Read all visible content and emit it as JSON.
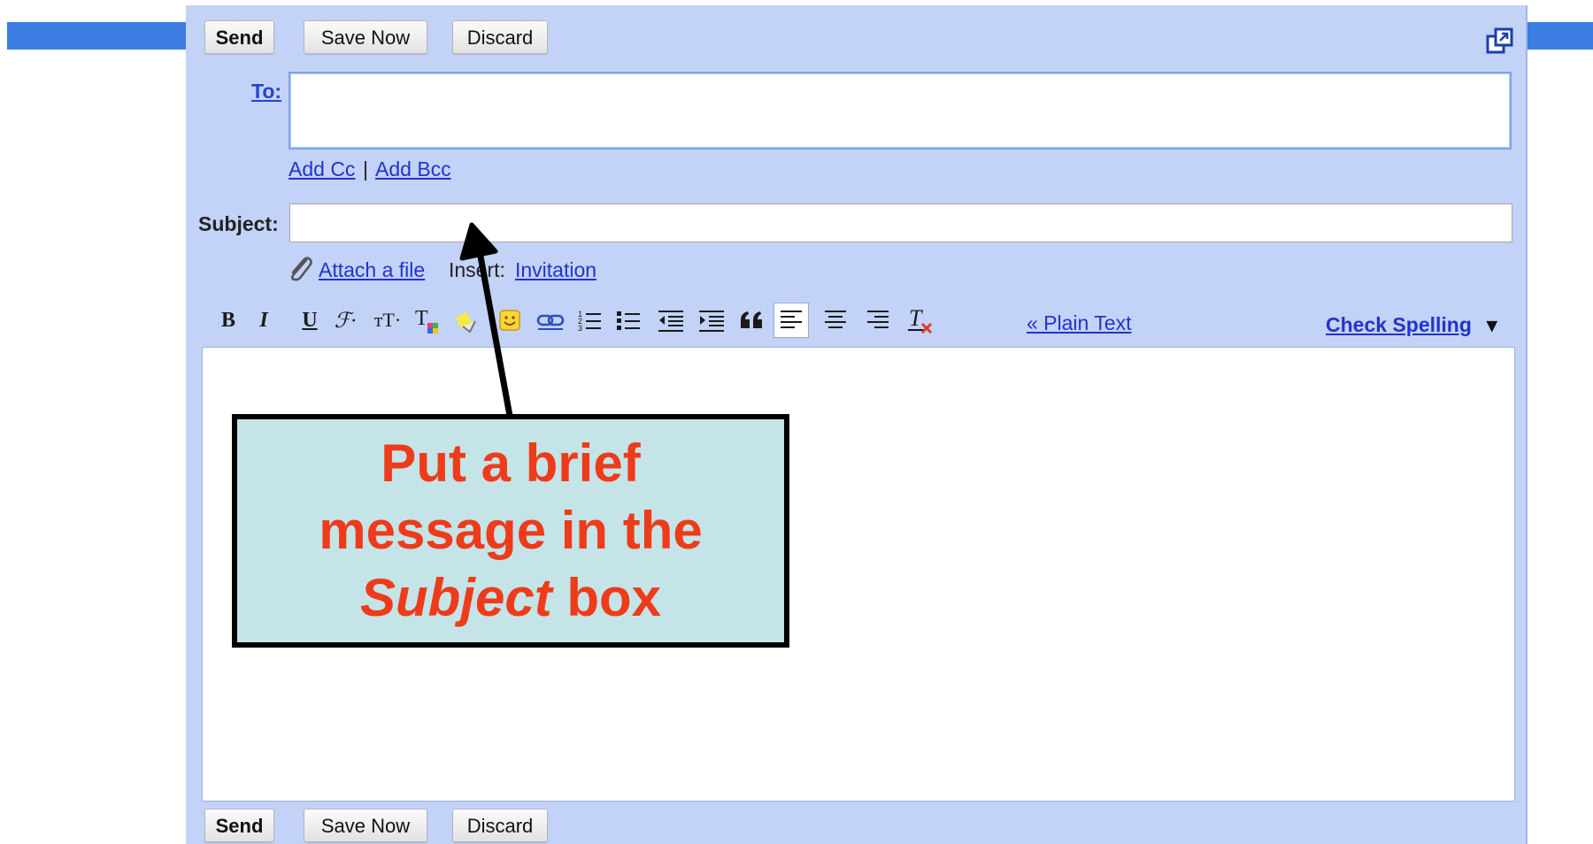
{
  "compose": {
    "top_buttons": {
      "send": "Send",
      "save_now": "Save Now",
      "discard": "Discard"
    },
    "bottom_buttons": {
      "send": "Send",
      "save_now": "Save Now",
      "discard": "Discard"
    },
    "to_label": "To:",
    "add_cc": "Add Cc",
    "separator": "|",
    "add_bcc": "Add Bcc",
    "subject_label": "Subject:",
    "attach_file": "Attach a file",
    "insert_label": "Insert:",
    "insert_invitation": "Invitation",
    "plain_text_link": "« Plain Text",
    "check_spelling": "Check Spelling",
    "check_spelling_arrow": "▾"
  },
  "toolbar": {
    "bold": "B",
    "italic": "I",
    "underline": "U",
    "font": "ℱ·",
    "size": "тT·",
    "icons": [
      "bold-icon",
      "italic-icon",
      "underline-icon",
      "font-icon",
      "text-size-icon",
      "text-color-icon",
      "highlight-icon",
      "emoticon-icon",
      "link-icon",
      "numbered-list-icon",
      "bulleted-list-icon",
      "outdent-icon",
      "indent-icon",
      "quote-icon",
      "align-left-icon",
      "align-center-icon",
      "align-right-icon",
      "remove-formatting-icon"
    ]
  },
  "callout": {
    "line1": "Put a brief",
    "line2": "message in the",
    "line3_italic": "Subject",
    "line3_rest": " box"
  },
  "colors": {
    "compose_bg": "#c3d2f7",
    "link": "#2233cc",
    "callout_bg": "#c4e4e8",
    "callout_text": "#ee3b1a",
    "top_bar": "#3b7de0"
  }
}
